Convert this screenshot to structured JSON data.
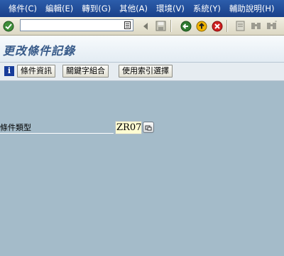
{
  "menubar": {
    "items": [
      "條件(C)",
      "編輯(E)",
      "轉到(G)",
      "其他(A)",
      "環境(V)",
      "系統(Y)",
      "輔助說明(H)"
    ]
  },
  "colors": {
    "menubar": "#1f4a96",
    "background": "#a4bbc9",
    "title": "#375a89",
    "input_bg": "#fffcd2"
  },
  "toolbar": {
    "icons": [
      "enter-icon",
      "save-icon",
      "back-icon",
      "exit-icon",
      "cancel-icon",
      "print-icon",
      "find-icon",
      "find-next-icon"
    ]
  },
  "title": "更改條件記錄",
  "app_toolbar": {
    "buttons": [
      "條件資訊",
      "關鍵字組合",
      "使用索引選擇"
    ]
  },
  "form": {
    "condition_type_label": "條件類型",
    "condition_type_value": "ZR07"
  }
}
